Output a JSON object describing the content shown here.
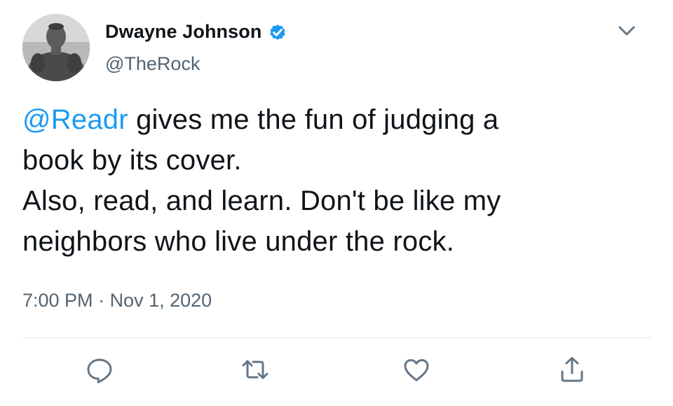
{
  "author": {
    "display_name": "Dwayne Johnson",
    "handle": "@TheRock",
    "verified": true
  },
  "tweet": {
    "mention": "@Readr",
    "line1_rest": " gives me the fun of judging a",
    "line2": "book by its cover.",
    "line3": "Also, read, and learn. Don't be like my",
    "line4": "neighbors who live under the rock."
  },
  "meta": {
    "time": "7:00 PM",
    "separator": " · ",
    "date": "Nov 1, 2020"
  },
  "icons": {
    "menu": "chevron-down-icon",
    "reply": "reply-icon",
    "retweet": "retweet-icon",
    "like": "heart-icon",
    "share": "share-icon",
    "verified": "verified-badge-icon"
  },
  "colors": {
    "accent": "#1d9bf0",
    "text": "#0f1419",
    "secondary": "#536471",
    "icon": "#657786",
    "divider": "#e1e8ed"
  }
}
